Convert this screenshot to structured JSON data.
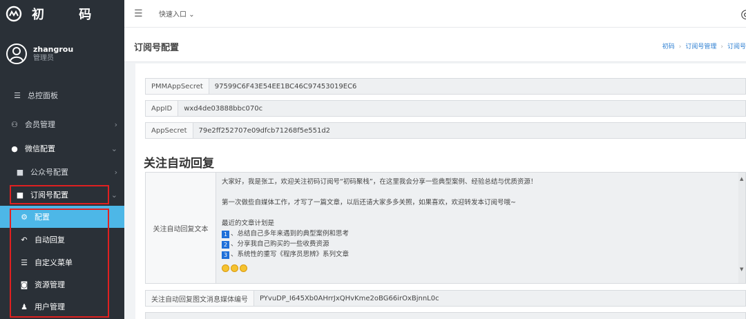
{
  "sidebar": {
    "brand": "初 码",
    "user": {
      "name": "zhangrou",
      "role": "管理员"
    },
    "items": [
      {
        "icon": "dashboard-icon",
        "label": "总控面板"
      },
      {
        "icon": "members-icon",
        "label": "会员管理"
      },
      {
        "icon": "wechat-icon",
        "label": "微信配置"
      },
      {
        "icon": "square-icon",
        "label": "公众号配置"
      },
      {
        "icon": "square-icon",
        "label": "订阅号配置"
      }
    ],
    "subitems": [
      {
        "icon": "gear-icon",
        "label": "配置"
      },
      {
        "icon": "reply-icon",
        "label": "自动回复"
      },
      {
        "icon": "list-icon",
        "label": "自定义菜单"
      },
      {
        "icon": "camera-icon",
        "label": "资源管理"
      },
      {
        "icon": "user-icon",
        "label": "用户管理"
      }
    ]
  },
  "topbar": {
    "quick_entry": "快速入口"
  },
  "page": {
    "title": "订阅号配置",
    "breadcrumb": [
      "初码",
      "订阅号管理",
      "订阅号"
    ]
  },
  "fields": [
    {
      "label": "PMMAppSecret",
      "value": "97599C6F43E54EE1BC46C97453019EC6"
    },
    {
      "label": "AppID",
      "value": "wxd4de03888bbc070c"
    },
    {
      "label": "AppSecret",
      "value": "79e2ff252707e09dfcb71268f5e551d2"
    }
  ],
  "auto_reply": {
    "section_title": "关注自动回复",
    "text_label": "关注自动回复文本",
    "line1": "大家好，我是张工，欢迎关注初码订阅号“初码聚栈”，在这里我会分享一些典型案例、经验总结与优质资源！",
    "line2": "第一次做些自媒体工作，才写了一篇文章，以后还请大家多多关照，如果喜欢，欢迎转发本订阅号哦~",
    "line3": "最近的文章计划是",
    "plan": [
      {
        "num": "1",
        "text": "、总结自己多年来遇到的典型案例和思考"
      },
      {
        "num": "2",
        "text": "、分享我自己购买的一些收费资源"
      },
      {
        "num": "3",
        "text": "、系统性的重写《程序员思辨》系列文章"
      }
    ],
    "media_label": "关注自动回复图文消息媒体编号",
    "media_value": "PYvuDP_I645Xb0AHrrJxQHvKme2oBG66irOxBjnnL0c"
  },
  "colors": {
    "sidebar_bg": "#2a3037",
    "active": "#4db7e7",
    "highlight_box": "#e02020",
    "link": "#2d7fd2"
  }
}
